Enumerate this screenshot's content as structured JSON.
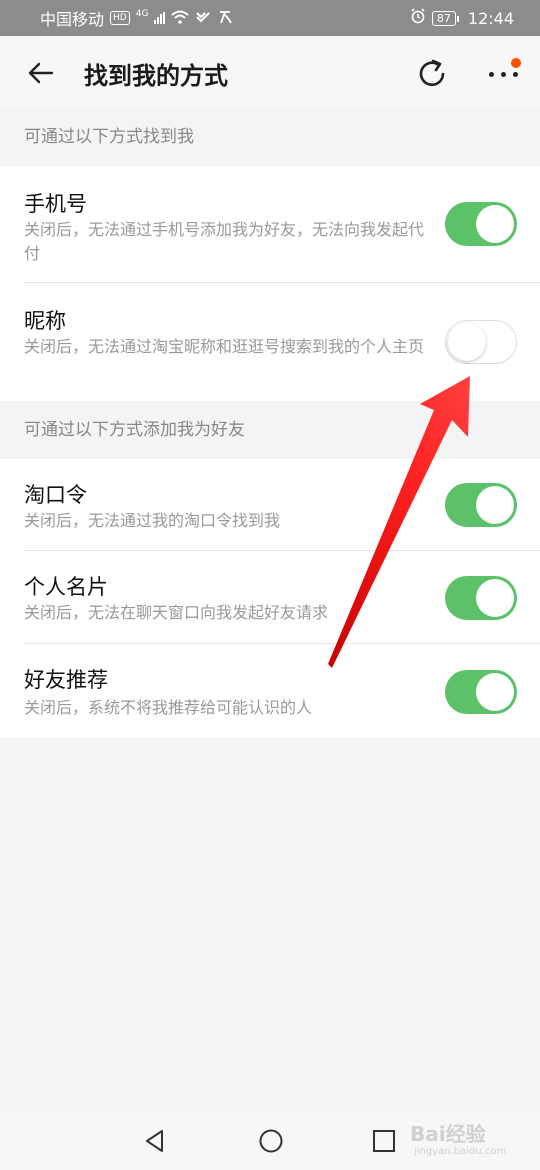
{
  "status_bar": {
    "carrier": "中国移动",
    "hd": "HD",
    "network": "4G",
    "battery": "87",
    "time": "12:44"
  },
  "header": {
    "title": "找到我的方式",
    "back_icon": "back-arrow-icon",
    "refresh_icon": "refresh-icon",
    "more_icon": "more-dots-icon"
  },
  "sections": [
    {
      "header": "可通过以下方式找到我",
      "items": [
        {
          "title": "手机号",
          "desc": "关闭后，无法通过手机号添加我为好友，无法向我发起代付",
          "enabled": true
        },
        {
          "title": "昵称",
          "desc": "关闭后，无法通过淘宝昵称和逛逛号搜索到我的个人主页",
          "enabled": false
        }
      ]
    },
    {
      "header": "可通过以下方式添加我为好友",
      "items": [
        {
          "title": "淘口令",
          "desc": "关闭后，无法通过我的淘口令找到我",
          "enabled": true
        },
        {
          "title": "个人名片",
          "desc": "关闭后，无法在聊天窗口向我发起好友请求",
          "enabled": true
        },
        {
          "title": "好友推荐",
          "desc": "关闭后，系统不将我推荐给可能认识的人",
          "enabled": true
        }
      ]
    }
  ],
  "watermark": {
    "text": "Bai经验",
    "sub": "jingyan.baidu.com"
  },
  "colors": {
    "toggle_on": "#5cc168",
    "accent": "#ff5000",
    "annotation": "#ff1a1a"
  }
}
